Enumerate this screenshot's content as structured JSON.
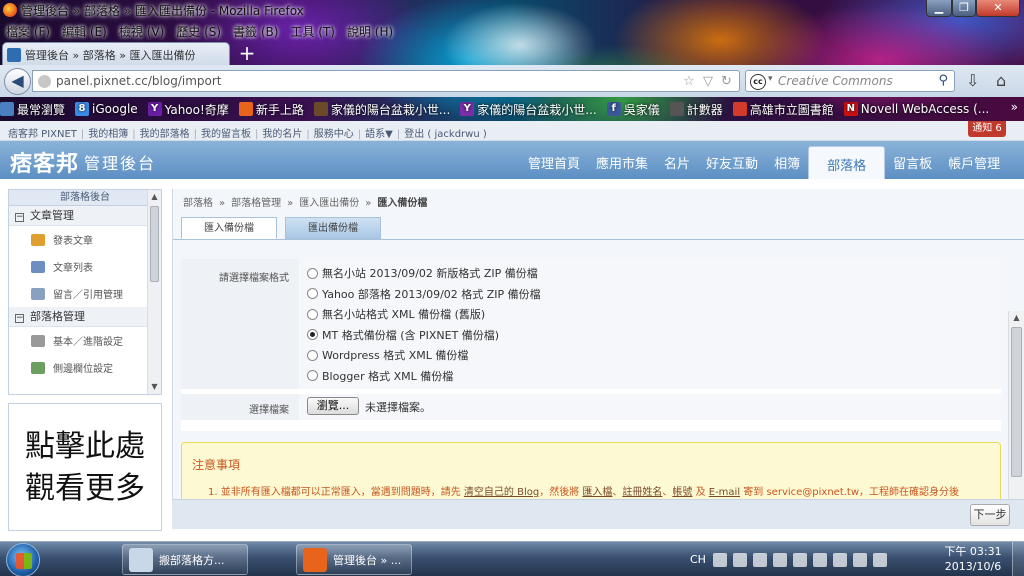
{
  "window": {
    "title": "管理後台 » 部落格 » 匯入匯出備份 - Mozilla Firefox"
  },
  "menubar": [
    "檔案 (F)",
    "編輯 (E)",
    "檢視 (V)",
    "歷史 (S)",
    "書籤 (B)",
    "工具 (T)",
    "說明 (H)"
  ],
  "tab": {
    "label": "管理後台 » 部落格 » 匯入匯出備份",
    "new_tab": "+"
  },
  "navbar": {
    "url": "panel.pixnet.cc/blog/import",
    "search_placeholder": "Creative Commons",
    "search_engine_badge": "cc"
  },
  "bookmarks": [
    {
      "label": "最常瀏覽",
      "icon_color": "#4a7fc1",
      "glyph": ""
    },
    {
      "label": "iGoogle",
      "icon_color": "#3a8be8",
      "glyph": "8"
    },
    {
      "label": "Yahoo!奇摩",
      "icon_color": "#6b1fa8",
      "glyph": "Y"
    },
    {
      "label": "新手上路",
      "icon_color": "#e8631b",
      "glyph": ""
    },
    {
      "label": "家儀的陽台盆栽小世...",
      "icon_color": "#6b4a2a",
      "glyph": ""
    },
    {
      "label": "家儀的陽台盆栽小世...",
      "icon_color": "#7a2fa8",
      "glyph": "Y"
    },
    {
      "label": "吳家儀",
      "icon_color": "#3b5998",
      "glyph": "f"
    },
    {
      "label": "計數器",
      "icon_color": "#555555",
      "glyph": ""
    },
    {
      "label": "高雄市立圖書館",
      "icon_color": "#d23b2b",
      "glyph": ""
    },
    {
      "label": "Novell WebAccess (...",
      "icon_color": "#cc1111",
      "glyph": "N"
    }
  ],
  "site": {
    "top_links": [
      "痞客邦 PIXNET",
      "我的相簿",
      "我的部落格",
      "我的留言板",
      "我的名片",
      "服務中心",
      "語系▼",
      "登出 ( jackdrwu )"
    ],
    "notify": "通知 6",
    "logo": "痞客邦",
    "site_title": "管理後台",
    "nav": [
      "管理首頁",
      "應用市集",
      "名片",
      "好友互動",
      "相簿",
      "部落格",
      "留言板",
      "帳戶管理"
    ],
    "nav_active": "部落格"
  },
  "sidebar": {
    "header": "部落格後台",
    "sections": [
      {
        "title": "文章管理",
        "items": [
          {
            "label": "發表文章",
            "icon_color": "#e0a030"
          },
          {
            "label": "文章列表",
            "icon_color": "#6a8fc0"
          },
          {
            "label": "留言／引用管理",
            "icon_color": "#8aa0c0"
          }
        ]
      },
      {
        "title": "部落格管理",
        "items": [
          {
            "label": "基本／進階設定",
            "icon_color": "#999999"
          },
          {
            "label": "側邊欄位設定",
            "icon_color": "#6a9f60"
          }
        ]
      }
    ],
    "ad_lines": [
      "點擊此處",
      "觀看更多"
    ]
  },
  "breadcrumb": [
    "部落格",
    "»",
    "部落格管理",
    "»",
    "匯入匯出備份",
    "»",
    "匯入備份檔"
  ],
  "subtabs": [
    {
      "label": "匯入備份檔",
      "active": true
    },
    {
      "label": "匯出備份檔",
      "active": false
    }
  ],
  "form": {
    "format_label": "請選擇檔案格式",
    "options": [
      {
        "label": "無名小站 2013/09/02 新版格式 ZIP 備份檔",
        "checked": false
      },
      {
        "label": "Yahoo 部落格 2013/09/02 格式 ZIP 備份檔",
        "checked": false
      },
      {
        "label": "無名小站格式 XML 備份檔 (舊版)",
        "checked": false
      },
      {
        "label": "MT 格式備份檔 (含 PIXNET 備份檔)",
        "checked": true
      },
      {
        "label": "Wordpress 格式 XML 備份檔",
        "checked": false
      },
      {
        "label": "Blogger 格式 XML 備份檔",
        "checked": false
      }
    ],
    "file_label": "選擇檔案",
    "browse_button": "瀏覽...",
    "no_file": "未選擇檔案。"
  },
  "notice": {
    "title": "注意事項",
    "line1_parts": [
      {
        "text": "1.  並非所有匯入檔都可以正常匯入，當遇到問題時，請先 ",
        "link": false
      },
      {
        "text": "清空自己的 Blog",
        "link": true
      },
      {
        "text": "，然後將 ",
        "link": false
      },
      {
        "text": "匯入檔",
        "link": true
      },
      {
        "text": "、",
        "link": false
      },
      {
        "text": "註冊姓名",
        "link": true
      },
      {
        "text": "、",
        "link": false
      },
      {
        "text": "帳號",
        "link": true
      },
      {
        "text": " 及 ",
        "link": false
      },
      {
        "text": "E-mail",
        "link": true
      },
      {
        "text": " 寄到 service@pixnet.tw，工程師在確認身分後",
        "link": false
      }
    ]
  },
  "next_button": "下一步",
  "taskbar": {
    "apps": [
      {
        "label": "",
        "icon_color": "#5a9fd8",
        "type": "icon"
      },
      {
        "label": "搬部落格方...",
        "icon_color": "#c8d8e8",
        "type": "button"
      },
      {
        "label": "",
        "icon_color": "#d0401a",
        "type": "icon"
      },
      {
        "label": "管理後台 » ...",
        "icon_color": "#e8631b",
        "type": "button"
      },
      {
        "label": "",
        "icon_color": "#2a8ae0",
        "type": "icon"
      },
      {
        "label": "",
        "icon_color": "#2b579a",
        "type": "icon"
      },
      {
        "label": "",
        "icon_color": "#e8c050",
        "type": "icon"
      },
      {
        "label": "",
        "icon_color": "#e87a1a",
        "type": "icon"
      }
    ],
    "tray_lang": "CH",
    "clock_time": "下午 03:31",
    "clock_date": "2013/10/6"
  }
}
